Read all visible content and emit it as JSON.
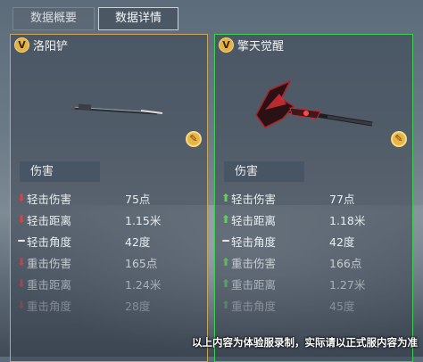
{
  "tabs": [
    {
      "label": "数据概要",
      "active": false
    },
    {
      "label": "数据详情",
      "active": true
    }
  ],
  "badge_letter": "V",
  "left": {
    "name": "洛阳铲",
    "section": "伤害",
    "rows": [
      {
        "arrow": "down",
        "label": "轻击伤害",
        "value": "75点"
      },
      {
        "arrow": "down",
        "label": "轻击距离",
        "value": "1.15米"
      },
      {
        "arrow": "same",
        "label": "轻击角度",
        "value": "42度"
      },
      {
        "arrow": "down",
        "label": "重击伤害",
        "value": "165点"
      },
      {
        "arrow": "down",
        "label": "重击距离",
        "value": "1.24米"
      },
      {
        "arrow": "down",
        "label": "重击角度",
        "value": "28度"
      }
    ]
  },
  "right": {
    "name": "擎天觉醒",
    "section": "伤害",
    "rows": [
      {
        "arrow": "up",
        "label": "轻击伤害",
        "value": "77点"
      },
      {
        "arrow": "up",
        "label": "轻击距离",
        "value": "1.18米"
      },
      {
        "arrow": "same",
        "label": "轻击角度",
        "value": "42度"
      },
      {
        "arrow": "up",
        "label": "重击伤害",
        "value": "166点"
      },
      {
        "arrow": "up",
        "label": "重击距离",
        "value": "1.27米"
      },
      {
        "arrow": "up",
        "label": "重击角度",
        "value": "45度"
      }
    ]
  },
  "glyphs": {
    "down": "⬇",
    "up": "⬆",
    "same": "━"
  },
  "colors": {
    "left_border": "#c9a45a",
    "right_border": "#3fcf52",
    "down": "#e53c3c",
    "up": "#5fd35a"
  },
  "caption": "以上内容为体验服录制，实际请以正式服内容为准"
}
